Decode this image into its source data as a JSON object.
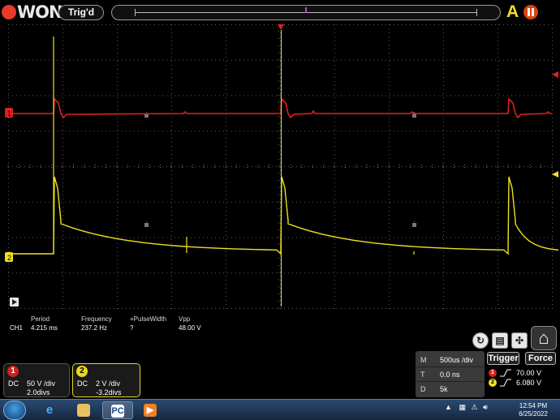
{
  "header": {
    "logo_text": "WON",
    "status": "Trig'd",
    "auto_label": "A"
  },
  "measurements": {
    "channel": "CH1",
    "headers": [
      "Period",
      "Frequency",
      "+PulseWidth",
      "Vpp"
    ],
    "values": [
      "4.215 ms",
      "237.2 Hz",
      "?",
      "48.00 V"
    ]
  },
  "channels": [
    {
      "number": "1",
      "coupling": "DC",
      "scale": "50 V /div",
      "offset": "2.0divs",
      "color": "#e02020"
    },
    {
      "number": "2",
      "coupling": "DC",
      "scale": "2 V /div",
      "offset": "-3.2divs",
      "color": "#f0e020"
    }
  ],
  "timebase": {
    "m_key": "M",
    "m_value": "500us /div",
    "t_key": "T",
    "t_value": "0.0 ns",
    "d_key": "D",
    "d_value": "5k"
  },
  "trigger": {
    "trigger_label": "Trigger",
    "force_label": "Force",
    "level_ch1": "70.00 V",
    "level_ch2": "6.080 V"
  },
  "markers": {
    "ch1": "1",
    "ch2": "2"
  },
  "taskbar": {
    "pc_label": "PC",
    "time": "12:54 PM",
    "date": "6/25/2022"
  }
}
